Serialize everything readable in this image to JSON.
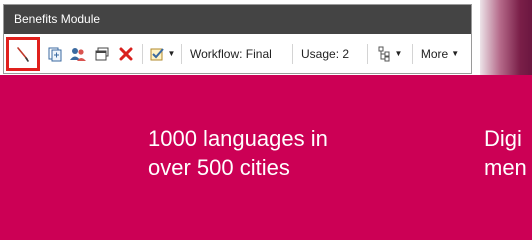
{
  "window": {
    "title": "Benefits Module"
  },
  "toolbar": {
    "workflow_label": "Workflow: Final",
    "usage_label": "Usage: 2",
    "more_label": "More"
  },
  "icons": {
    "edit": "pencil-icon",
    "duplicate": "duplicate-icon",
    "users": "users-icon",
    "windows": "windows-icon",
    "delete": "delete-icon",
    "approve": "approve-icon",
    "tree": "tree-icon"
  },
  "background": {
    "line1": "1000 languages in",
    "line2": "over 500 cities",
    "right_line1": "Digi",
    "right_line2": "men"
  },
  "colors": {
    "brand_magenta": "#cc0055",
    "highlight": "#e0201d",
    "titlebar": "#444444"
  }
}
